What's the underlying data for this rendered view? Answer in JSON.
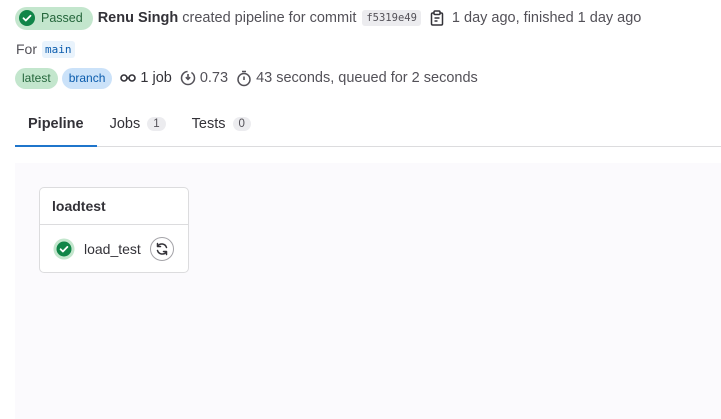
{
  "header": {
    "status_label": "Passed",
    "author": "Renu Singh",
    "action_text": "created pipeline for commit",
    "commit_sha": "f5319e49",
    "time_text": "1 day ago, finished 1 day ago",
    "for_label": "For",
    "ref": "main"
  },
  "meta": {
    "badges": [
      "latest",
      "branch"
    ],
    "jobs_text": "1 job",
    "score": "0.73",
    "duration_text": "43 seconds, queued for 2 seconds"
  },
  "tabs": [
    {
      "label": "Pipeline",
      "count": null,
      "active": true
    },
    {
      "label": "Jobs",
      "count": "1",
      "active": false
    },
    {
      "label": "Tests",
      "count": "0",
      "active": false
    }
  ],
  "graph": {
    "stage_name": "loadtest",
    "job_name": "load_test"
  },
  "colors": {
    "success": "#108548",
    "success_bg": "#c3e6cd",
    "tab_underline": "#1f75cb"
  },
  "icons": {
    "status": "check-circle-icon",
    "copy": "copy-to-clipboard-icon",
    "jobs": "pipeline-icon",
    "score": "time-out-icon",
    "duration": "timer-icon",
    "retry": "retry-icon"
  }
}
